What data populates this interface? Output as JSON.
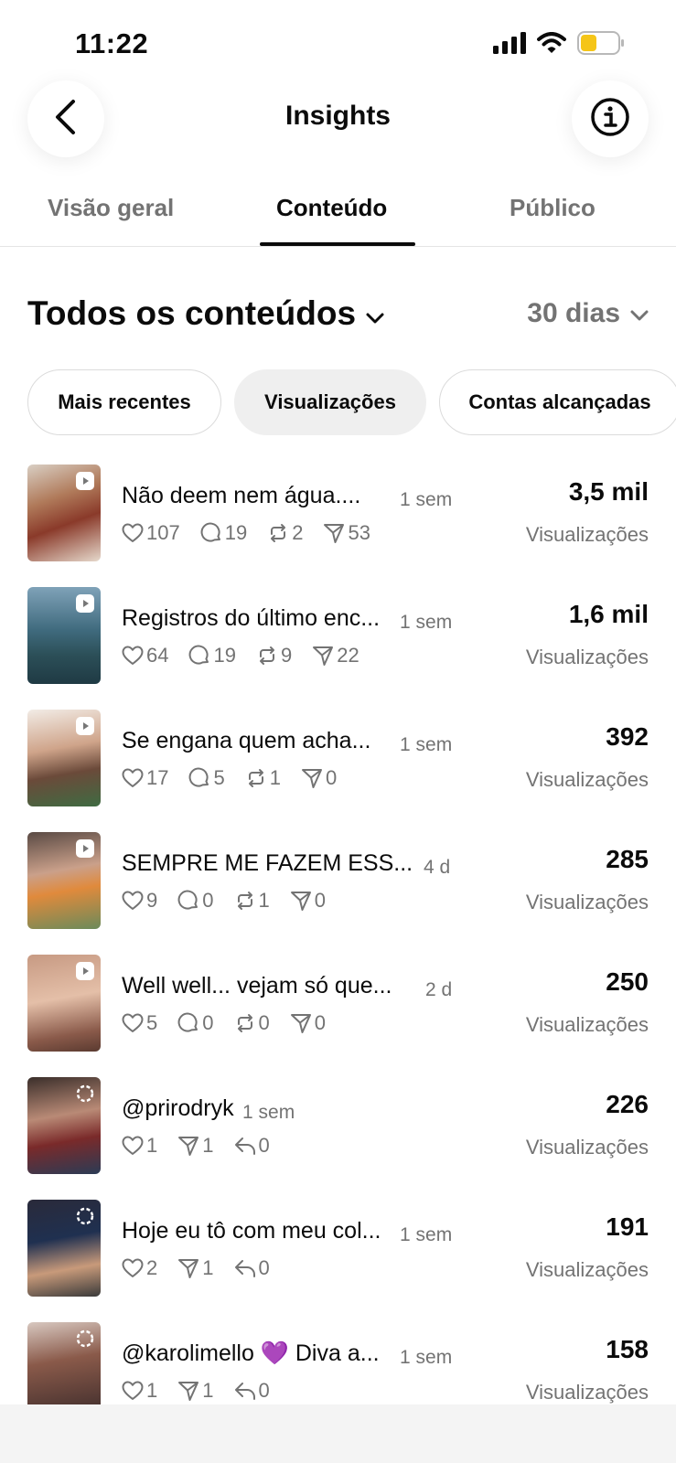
{
  "status_bar": {
    "time": "11:22"
  },
  "header": {
    "title": "Insights",
    "back_icon": "chevron-left-icon",
    "info_icon": "info-icon"
  },
  "tabs": [
    {
      "label": "Visão geral",
      "active": false
    },
    {
      "label": "Conteúdo",
      "active": true
    },
    {
      "label": "Público",
      "active": false
    }
  ],
  "filter": {
    "title": "Todos os conteúdos",
    "period": "30 dias"
  },
  "chips": [
    {
      "label": "Mais recentes",
      "selected": false
    },
    {
      "label": "Visualizações",
      "selected": true
    },
    {
      "label": "Contas alcançadas",
      "selected": false
    }
  ],
  "metric_label": "Visualizações",
  "items": [
    {
      "caption": "Não deem nem água....",
      "age": "1 sem",
      "type": "reel",
      "value": "3,5 mil",
      "stats": [
        {
          "icon": "heart",
          "value": "107"
        },
        {
          "icon": "comment",
          "value": "19"
        },
        {
          "icon": "repost",
          "value": "2"
        },
        {
          "icon": "share",
          "value": "53"
        }
      ]
    },
    {
      "caption": "Registros do último enc...",
      "age": "1 sem",
      "type": "reel",
      "value": "1,6 mil",
      "stats": [
        {
          "icon": "heart",
          "value": "64"
        },
        {
          "icon": "comment",
          "value": "19"
        },
        {
          "icon": "repost",
          "value": "9"
        },
        {
          "icon": "share",
          "value": "22"
        }
      ]
    },
    {
      "caption": "Se engana quem acha...",
      "age": "1 sem",
      "type": "reel",
      "value": "392",
      "stats": [
        {
          "icon": "heart",
          "value": "17"
        },
        {
          "icon": "comment",
          "value": "5"
        },
        {
          "icon": "repost",
          "value": "1"
        },
        {
          "icon": "share",
          "value": "0"
        }
      ]
    },
    {
      "caption": "SEMPRE ME FAZEM ESS...",
      "age": "4 d",
      "type": "reel",
      "value": "285",
      "stats": [
        {
          "icon": "heart",
          "value": "9"
        },
        {
          "icon": "comment",
          "value": "0"
        },
        {
          "icon": "repost",
          "value": "1"
        },
        {
          "icon": "share",
          "value": "0"
        }
      ]
    },
    {
      "caption": "Well well... vejam só que...",
      "age": "2 d",
      "type": "reel",
      "value": "250",
      "stats": [
        {
          "icon": "heart",
          "value": "5"
        },
        {
          "icon": "comment",
          "value": "0"
        },
        {
          "icon": "repost",
          "value": "0"
        },
        {
          "icon": "share",
          "value": "0"
        }
      ]
    },
    {
      "caption": "@prirodryk",
      "age": "1 sem",
      "type": "story",
      "value": "226",
      "stats": [
        {
          "icon": "heart",
          "value": "1"
        },
        {
          "icon": "share",
          "value": "1"
        },
        {
          "icon": "reply",
          "value": "0"
        }
      ]
    },
    {
      "caption": "Hoje eu tô com meu col...",
      "age": "1 sem",
      "type": "story",
      "value": "191",
      "stats": [
        {
          "icon": "heart",
          "value": "2"
        },
        {
          "icon": "share",
          "value": "1"
        },
        {
          "icon": "reply",
          "value": "0"
        }
      ]
    },
    {
      "caption": "@karolimello 💜 Diva a...",
      "age": "1 sem",
      "type": "story",
      "value": "158",
      "stats": [
        {
          "icon": "heart",
          "value": "1"
        },
        {
          "icon": "share",
          "value": "1"
        },
        {
          "icon": "reply",
          "value": "0"
        }
      ]
    }
  ],
  "colors": {
    "text": "#0b0b0b",
    "muted": "#737373",
    "chip_selected": "#efefef",
    "battery": "#f5c518"
  }
}
